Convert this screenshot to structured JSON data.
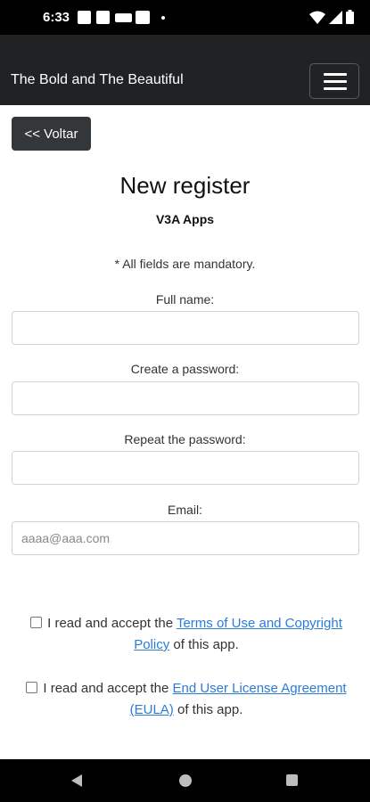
{
  "status_bar": {
    "time": "6:33"
  },
  "navbar": {
    "brand": "The Bold and The Beautiful"
  },
  "back_button": {
    "label": "<< Voltar"
  },
  "page": {
    "title": "New register",
    "subtitle": "V3A Apps",
    "mandatory_note": "* All fields are mandatory."
  },
  "form": {
    "full_name_label": "Full name:",
    "password_label": "Create a password:",
    "repeat_password_label": "Repeat the password:",
    "email_label": "Email:",
    "email_placeholder": "aaaa@aaa.com"
  },
  "terms": {
    "prefix": "I read and accept the ",
    "link": "Terms of Use and Copyright Policy",
    "suffix": " of this app.",
    "checked": false
  },
  "eula": {
    "prefix": "I read and accept the ",
    "link": "End User License Agreement (EULA)",
    "suffix": " of this app.",
    "checked": false
  }
}
